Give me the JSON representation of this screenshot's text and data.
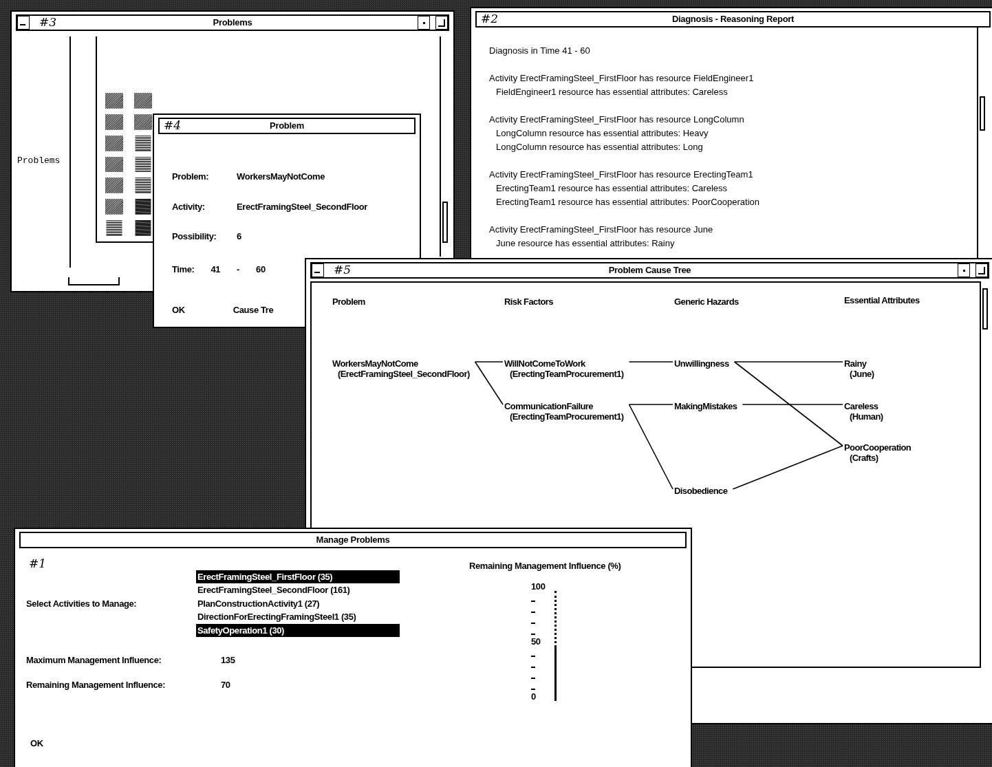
{
  "problems_window": {
    "annotation": "#3",
    "title": "Problems",
    "list_label": "Problems",
    "tile_columns": [
      [
        {
          "kind": "diagonal"
        },
        {
          "kind": "diagonal"
        },
        {
          "kind": "diagonal"
        },
        {
          "kind": "diagonal"
        },
        {
          "kind": "diagonal"
        },
        {
          "kind": "diagonal"
        },
        {
          "kind": "horizontal"
        }
      ],
      [
        {
          "kind": "diagonal"
        },
        {
          "kind": "diagonal"
        },
        {
          "kind": "horizontal"
        },
        {
          "kind": "horizontal"
        },
        {
          "kind": "horizontal"
        },
        {
          "kind": "dark"
        },
        {
          "kind": "dark"
        }
      ]
    ]
  },
  "problem_dialog": {
    "annotation": "#4",
    "title": "Problem",
    "fields": [
      {
        "label": "Problem:",
        "value": "WorkersMayNotCome"
      },
      {
        "label": "Activity:",
        "value": "ErectFramingSteel_SecondFloor"
      },
      {
        "label": "Possibility:",
        "value": "6"
      }
    ],
    "time": {
      "label": "Time:",
      "from": "41",
      "dash": "-",
      "to": "60"
    },
    "buttons": [
      "OK",
      "Cause Tre"
    ]
  },
  "report_window": {
    "annotation": "#2",
    "title": "Diagnosis - Reasoning Report",
    "heading": "Diagnosis in Time 41 - 60",
    "groups": [
      {
        "activity": "Activity ErectFramingSteel_FirstFloor has resource FieldEngineer1",
        "attributes": [
          "FieldEngineer1 resource has essential attributes: Careless"
        ]
      },
      {
        "activity": "Activity ErectFramingSteel_FirstFloor has resource LongColumn",
        "attributes": [
          "LongColumn resource has essential attributes: Heavy",
          "LongColumn resource has essential attributes: Long"
        ]
      },
      {
        "activity": "Activity ErectFramingSteel_FirstFloor has resource ErectingTeam1",
        "attributes": [
          "ErectingTeam1 resource has essential attributes: Careless",
          "ErectingTeam1 resource has essential attributes: PoorCooperation"
        ]
      },
      {
        "activity": "Activity ErectFramingSteel_FirstFloor has resource June",
        "attributes": [
          "June resource has essential attributes: Rainy"
        ]
      }
    ]
  },
  "tree_window": {
    "annotation": "#5",
    "title": "Problem Cause Tree",
    "columns": [
      {
        "header": "Problem",
        "nodes": [
          {
            "name": "WorkersMayNotCome",
            "detail": "(ErectFramingSteel_SecondFloor)"
          }
        ]
      },
      {
        "header": "Risk Factors",
        "nodes": [
          {
            "name": "WillNotComeToWork",
            "detail": "(ErectingTeamProcurement1)"
          },
          {
            "name": "CommunicationFailure",
            "detail": "(ErectingTeamProcurement1)"
          }
        ]
      },
      {
        "header": "Generic Hazards",
        "nodes": [
          {
            "name": "Unwillingness"
          },
          {
            "name": "MakingMistakes"
          },
          {
            "name": "Disobedience"
          }
        ]
      },
      {
        "header": "Essential Attributes",
        "nodes": [
          {
            "name": "Rainy",
            "detail": "(June)"
          },
          {
            "name": "Careless",
            "detail": "(Human)"
          },
          {
            "name": "PoorCooperation",
            "detail": "(Crafts)"
          }
        ]
      }
    ]
  },
  "manage_window": {
    "annotation": "#1",
    "title": "Manage Problems",
    "select_label": "Select Activities to Manage:",
    "activities": [
      {
        "label": "ErectFramingSteel_FirstFloor (35)",
        "selected": true
      },
      {
        "label": "ErectFramingSteel_SecondFloor (161)",
        "selected": false
      },
      {
        "label": "PlanConstructionActivity1 (27)",
        "selected": false
      },
      {
        "label": "DirectionForErectingFramingSteel1 (35)",
        "selected": false
      },
      {
        "label": "SafetyOperation1 (30)",
        "selected": true
      }
    ],
    "max_label": "Maximum Management Influence:",
    "max_value": "135",
    "remaining_label": "Remaining Management Influence:",
    "remaining_value": "70",
    "meter": {
      "title": "Remaining Management Influence (%)",
      "scale": [
        "100",
        "50",
        "0"
      ],
      "level": 0.5
    },
    "ok": "OK"
  }
}
